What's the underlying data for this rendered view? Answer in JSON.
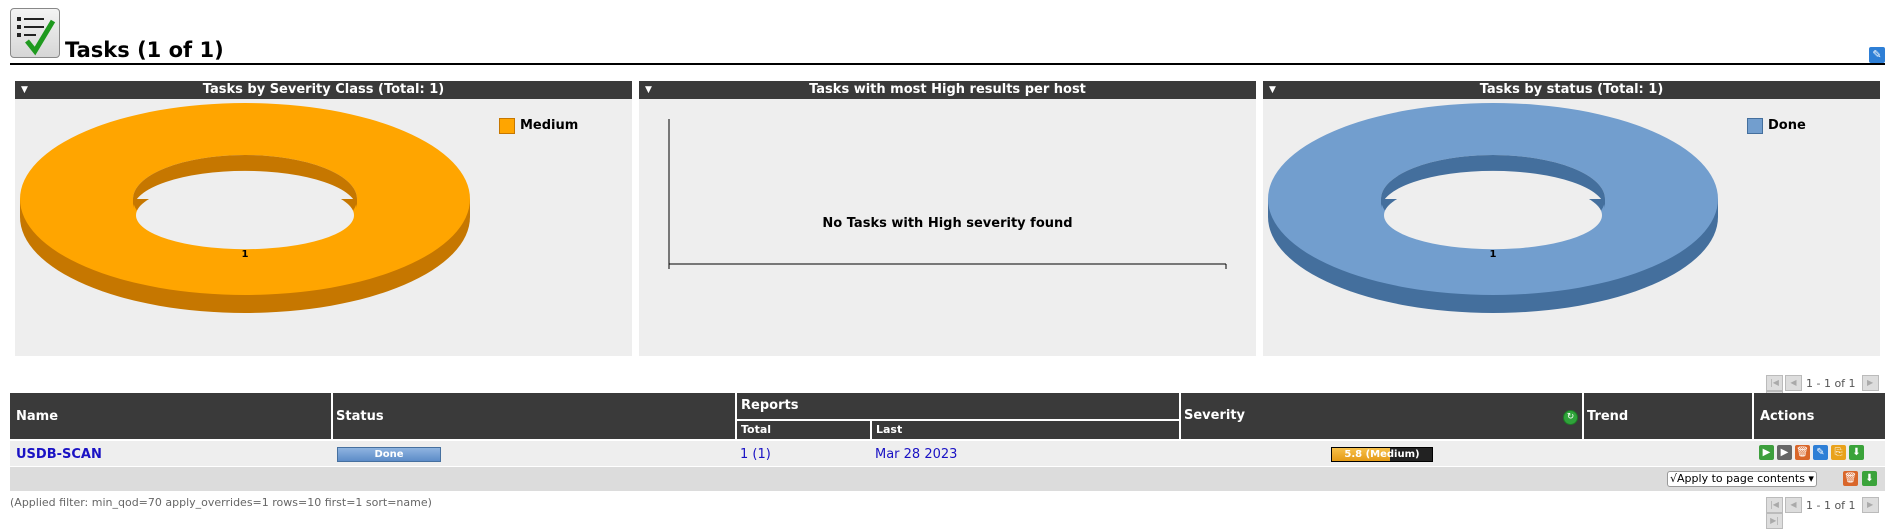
{
  "header": {
    "title": "Tasks (1 of 1)",
    "logo_icon": "task-list-check-icon"
  },
  "panels": [
    {
      "title": "Tasks by Severity Class (Total: 1)",
      "legend": "Medium",
      "color": "#ffa500",
      "dark": "#c67700",
      "value_label": "1",
      "count": 1
    },
    {
      "title": "Tasks with most High results per host",
      "no_data": "No Tasks with High severity found"
    },
    {
      "title": "Tasks by status (Total: 1)",
      "legend": "Done",
      "color": "#729ece",
      "dark": "#446f9d",
      "value_label": "1",
      "count": 1
    }
  ],
  "pager": {
    "text": "1 - 1 of 1"
  },
  "table": {
    "headers": {
      "name": "Name",
      "status": "Status",
      "reports": "Reports",
      "total": "Total",
      "last": "Last",
      "severity": "Severity",
      "trend": "Trend",
      "actions": "Actions"
    },
    "rows": [
      {
        "name": "USDB-SCAN",
        "status": "Done",
        "total": "1 (1)",
        "last": "Mar 28 2023",
        "severity": "5.8 (Medium)",
        "severity_score": 5.8,
        "trend": ""
      }
    ],
    "apply_label": "√Apply to page contents",
    "filter_text": "(Applied filter: min_qod=70 apply_overrides=1 rows=10 first=1 sort=name)"
  },
  "colors": {
    "header_bg": "#3a3a3a",
    "panel_bg": "#eeeeee",
    "link": "#1a12c4"
  }
}
